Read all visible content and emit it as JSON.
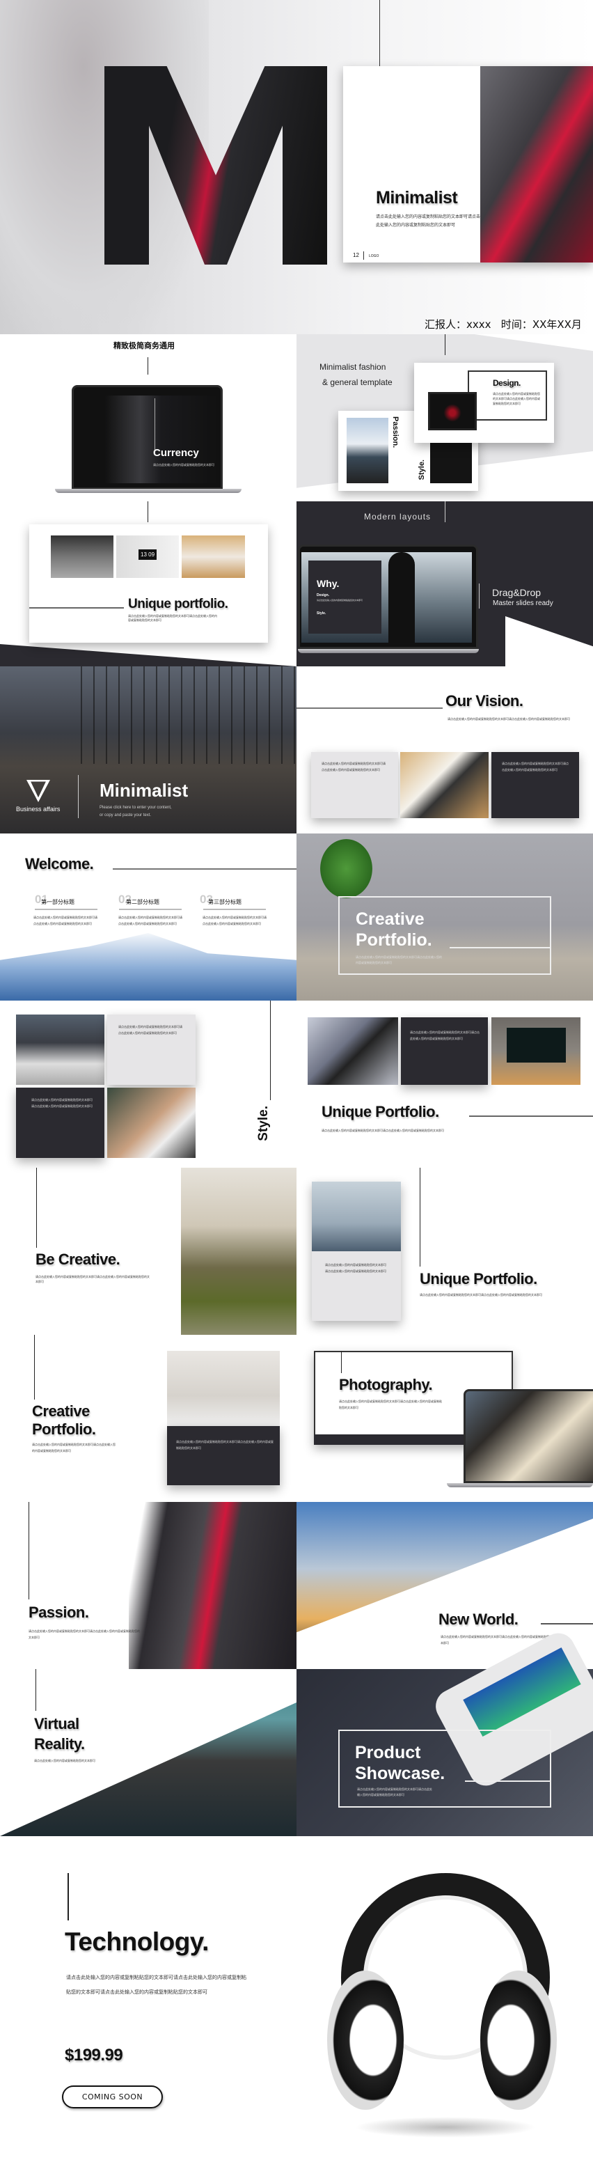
{
  "placeholder_body": "请点击此处输入您的内容或复制粘贴您的文本即可请点击此处输入您的内容或复制粘贴您的文本即可",
  "placeholder_short": "请点击此处输入您的内容或复制粘贴您的文本即可",
  "hero": {
    "title": "Minimalist",
    "body": "请点击此处输入您的内容或复制粘贴您的文本即可请点击此处输入您的内容或复制粘贴您的文本即可",
    "page_number": "12",
    "logo": "LOGO",
    "reporter": "汇报人：xxxx   时间：XX年XX月"
  },
  "slide2": {
    "subtitle": "精致极简商务通用",
    "laptop_title": "Currency",
    "tagline_1": "Minimalist fashion",
    "tagline_2": "& general template",
    "design": "Design.",
    "passion": "Passion.",
    "style": "Style."
  },
  "slide3": {
    "title": "Unique portfolio.",
    "clock": "13 09",
    "modern": "Modern layouts",
    "why": "Why.",
    "design": "Design.",
    "style": "Style.",
    "drag": "Drag&Drop",
    "master": "Master slides ready"
  },
  "slide4": {
    "title": "Minimalist",
    "business": "Business affairs",
    "sub_1": "Please click here to enter your content,",
    "sub_2": "or copy and paste your text.",
    "vision": "Our Vision."
  },
  "slide5": {
    "welcome": "Welcome.",
    "sections": [
      {
        "num": "01",
        "label": "第一部分标题"
      },
      {
        "num": "02",
        "label": "第二部分标题"
      },
      {
        "num": "03",
        "label": "第三部分标题"
      }
    ],
    "creative_1": "Creative",
    "creative_2": "Portfolio."
  },
  "slide6": {
    "style": "Style.",
    "unique": "Unique Portfolio."
  },
  "slide7": {
    "be_creative": "Be Creative.",
    "unique": "Unique Portfolio."
  },
  "slide8": {
    "creative_1": "Creative",
    "creative_2": "Portfolio.",
    "photography": "Photography."
  },
  "slide9": {
    "passion": "Passion.",
    "new_world": "New World."
  },
  "slide10": {
    "virtual_1": "Virtual",
    "virtual_2": "Reality.",
    "product_1": "Product",
    "product_2": "Showcase."
  },
  "slide11": {
    "title": "Technology.",
    "body": "请点击此处输入您的内容或复制粘贴您的文本即可请点击此处输入您的内容或复制粘贴您的文本即可请点击此处输入您的内容或复制粘贴您的文本即可",
    "price": "$199.99",
    "cta": "COMING SOON"
  },
  "colors": {
    "accent_red": "#e0163a",
    "dark_panel": "#2b2a30",
    "light_panel": "#e6e5e7"
  }
}
